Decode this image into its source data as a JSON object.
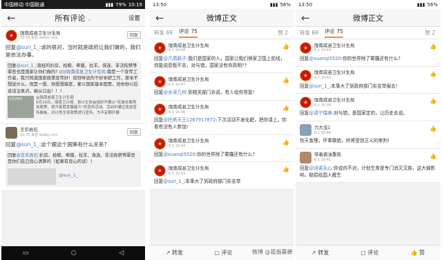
{
  "p1": {
    "status_left_1": "中国移动",
    "status_left_2": "中国联通",
    "status_battery": "79%",
    "status_time": "10:19",
    "title": "所有评论",
    "settings": "设置",
    "c1": {
      "name": "陇南成县卫生计生局",
      "time": "08:54",
      "source": "来自 weibo.com",
      "reply": "回复",
      "text_a": "回复",
      "at": "@sun_1_",
      "text_b": ":说的很对，当时就是政府让我们做的，我们是依法办事。",
      "quote_a": "回复",
      "quote_at1": "@sun_1_",
      "quote_b": ":曾经的扒房、抢粮、牵猪、拉羊、诛连、非法拘禁等罪恶也是国家让你们做的? //",
      "quote_at2": "@陇南成县卫生计生局",
      "quote_c": ":我是一个宣传工作者，我只知道国家政策宣传好！按领导说的干好本职工作，原本不想说什么，但是一想，你想想搞宽，宴以国家基本国策，劝你你以后说话注意点，祸从口出！！！",
      "card_at": "@陇南成县卫生计生局",
      "card_line1": "5月29日，成县卫计局、县计生协会组织开展以“实施全面两孩政策，提升家庭发展能力”的宣传活动。活动中通过发放宣传展板，对计划生育政策进行宣传，为不定期开展",
      "card_img": "5月29日"
    },
    "c2": {
      "name": "言实岩石",
      "time": "22:33",
      "source": "来自 weibo.com",
      "reply": "回复",
      "text_a": "回复",
      "at": "@sun_1_",
      "text_b": ":这个跟这个国策有什么关系?",
      "quote_a": "回复",
      "quote_at1": "@言实岩石",
      "quote_b": ":扒房、抢粮、牵猪、拉羊、诛连、非法拘禁等罪恶是你们自己良心清算的（如果有良心的话）！",
      "sub_at": "@sun_1_"
    }
  },
  "p2": {
    "status_time": "13:50",
    "status_battery": "56%",
    "title": "微博正文",
    "tab_forward": "转发 69",
    "tab_comment": "评论 75",
    "tab_like": "赞 2",
    "items": [
      {
        "name": "陇南成县卫生计生局",
        "time": "6-1 10:48",
        "a": "回复",
        "at": "@凡情羁子",
        "b": ":我们是国家的人，国家让我们保家卫国上前线，你能说怨我不去，对与错，国家没有你高明??"
      },
      {
        "name": "陇南成县卫生计生局",
        "time": "6-1 10:47",
        "a": "回复",
        "at": "@水深几何",
        "b": ":到相关部门去说，有人给你答复！"
      },
      {
        "name": "陇南成县卫生计生局",
        "time": "6-1 10:46",
        "a": "回复",
        "at": "@托塔天王1267917872",
        "b": ":下次活动不发化肥，把你请上，你看有没有人参加!"
      },
      {
        "name": "陇南成县卫生计生局",
        "time": "6-1 10:44",
        "a": "回复",
        "at": "@xuanqi5520",
        "b": ":你的世界除了雾霾还有什么?"
      },
      {
        "name": "陇南成县卫生计生局",
        "time": "6-1 10:43",
        "a": "回复",
        "at": "@sun_1_",
        "b": ":本事大了到政府部门实名举"
      }
    ],
    "bar_forward": "转发",
    "bar_comment": "评论",
    "bar_like": "赞"
  },
  "p3": {
    "status_time": "13:50",
    "status_battery": "56%",
    "title": "微博正文",
    "tab_forward": "转发 69",
    "tab_comment": "评论 75",
    "tab_like": "赞 2",
    "items": [
      {
        "name": "陇南成县卫生计生局",
        "time": "6-1 10:44",
        "a": "回复",
        "at": "@xuanqi5520",
        "b": ":你的世界除了雾霾还有什么?",
        "icon": "seal"
      },
      {
        "name": "陇南成县卫生计生局",
        "time": "6-1 10:43",
        "a": "回复",
        "at": "@sun_1_",
        "b": ":本事大了到政府部门实名举报去!",
        "icon": "seal"
      },
      {
        "name": "陇南成县卫生计生局",
        "time": "6-1 10:38",
        "a": "回复",
        "at": "@清宁瑞美",
        "b": ":对与错，是国家定的，让历史去说。",
        "icon": "seal"
      },
      {
        "name": "力大虫1",
        "time": "6-1 10:44",
        "a": "",
        "at": "",
        "b": "伤天害理，坏事做绝，终将受到正义的审判!",
        "icon": "photo"
      },
      {
        "name": "带着酱油重现",
        "time": "6-1 10:41",
        "a": "回复",
        "at": "@诗诺无心",
        "b": ":你说的不对，计划生育是专门消灭汉族，这大搞影响，赔偿给国人醒生",
        "icon": "photo2"
      }
    ],
    "bar_forward": "转发",
    "bar_comment": "评论",
    "bar_like": "赞"
  },
  "watermark": "微博 @孤烟暮蝉"
}
